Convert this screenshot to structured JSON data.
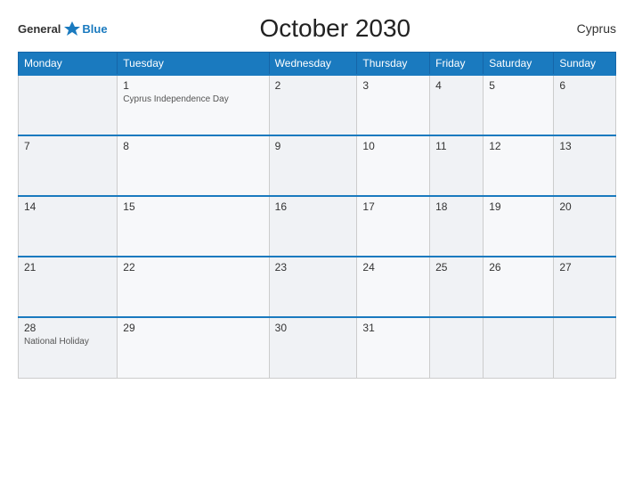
{
  "header": {
    "logo_general": "General",
    "logo_blue": "Blue",
    "title": "October 2030",
    "country": "Cyprus"
  },
  "calendar": {
    "days_of_week": [
      "Monday",
      "Tuesday",
      "Wednesday",
      "Thursday",
      "Friday",
      "Saturday",
      "Sunday"
    ],
    "weeks": [
      [
        {
          "day": "",
          "holiday": ""
        },
        {
          "day": "1",
          "holiday": "Cyprus\nIndependence Day"
        },
        {
          "day": "2",
          "holiday": ""
        },
        {
          "day": "3",
          "holiday": ""
        },
        {
          "day": "4",
          "holiday": ""
        },
        {
          "day": "5",
          "holiday": ""
        },
        {
          "day": "6",
          "holiday": ""
        }
      ],
      [
        {
          "day": "7",
          "holiday": ""
        },
        {
          "day": "8",
          "holiday": ""
        },
        {
          "day": "9",
          "holiday": ""
        },
        {
          "day": "10",
          "holiday": ""
        },
        {
          "day": "11",
          "holiday": ""
        },
        {
          "day": "12",
          "holiday": ""
        },
        {
          "day": "13",
          "holiday": ""
        }
      ],
      [
        {
          "day": "14",
          "holiday": ""
        },
        {
          "day": "15",
          "holiday": ""
        },
        {
          "day": "16",
          "holiday": ""
        },
        {
          "day": "17",
          "holiday": ""
        },
        {
          "day": "18",
          "holiday": ""
        },
        {
          "day": "19",
          "holiday": ""
        },
        {
          "day": "20",
          "holiday": ""
        }
      ],
      [
        {
          "day": "21",
          "holiday": ""
        },
        {
          "day": "22",
          "holiday": ""
        },
        {
          "day": "23",
          "holiday": ""
        },
        {
          "day": "24",
          "holiday": ""
        },
        {
          "day": "25",
          "holiday": ""
        },
        {
          "day": "26",
          "holiday": ""
        },
        {
          "day": "27",
          "holiday": ""
        }
      ],
      [
        {
          "day": "28",
          "holiday": "National Holiday"
        },
        {
          "day": "29",
          "holiday": ""
        },
        {
          "day": "30",
          "holiday": ""
        },
        {
          "day": "31",
          "holiday": ""
        },
        {
          "day": "",
          "holiday": ""
        },
        {
          "day": "",
          "holiday": ""
        },
        {
          "day": "",
          "holiday": ""
        }
      ]
    ]
  }
}
